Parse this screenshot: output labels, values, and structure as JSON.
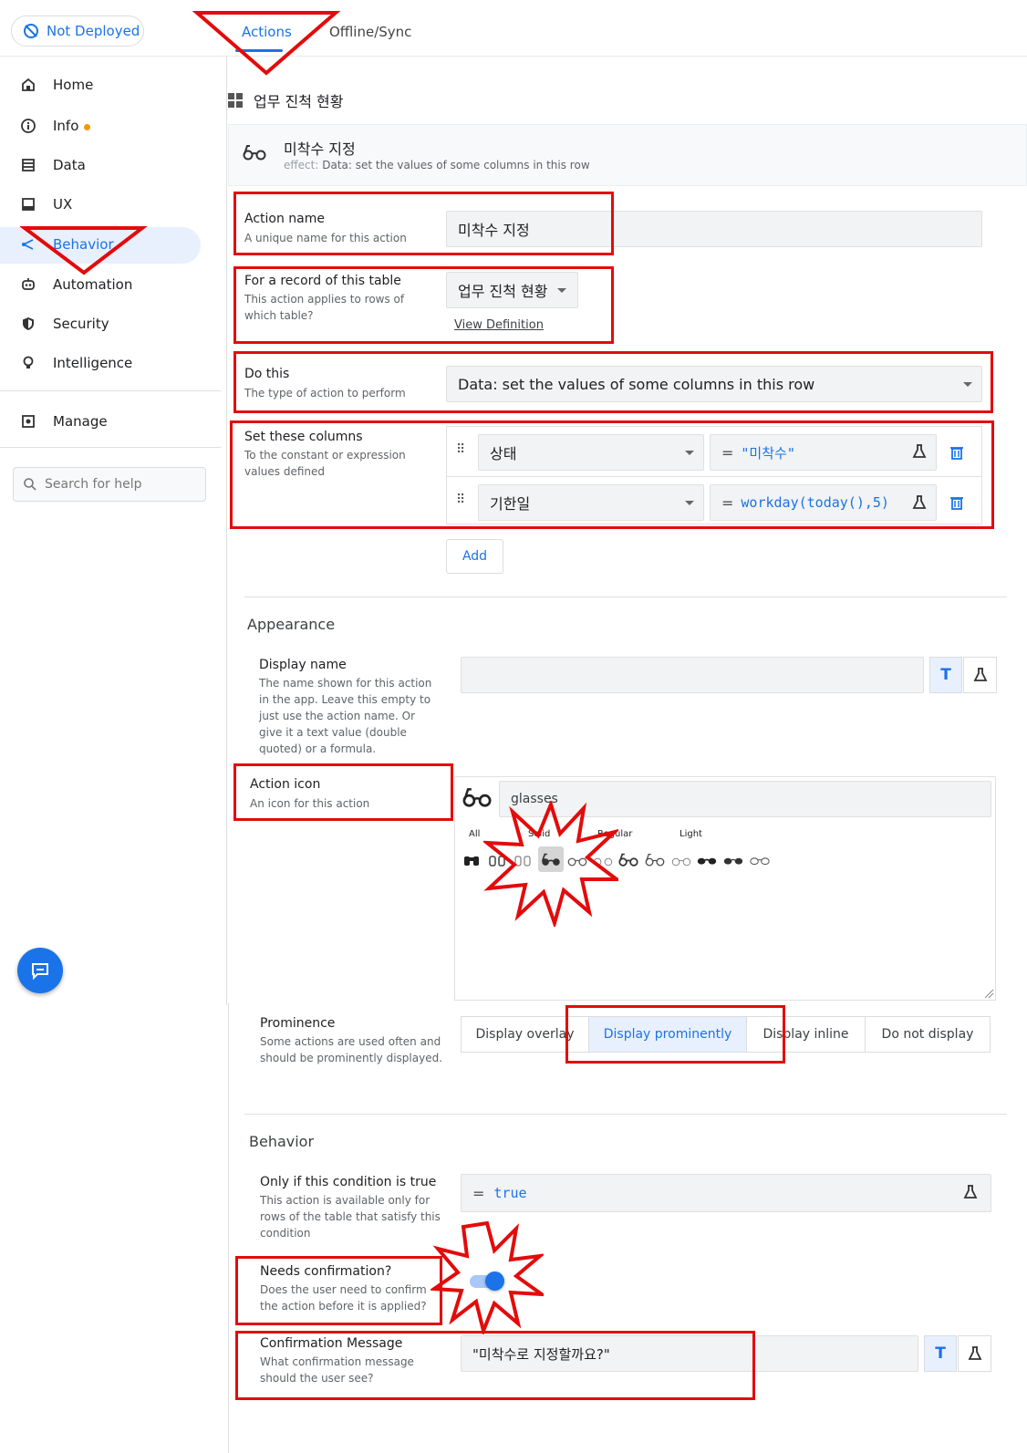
{
  "top": {
    "deploy_label": "Not Deployed",
    "tabs": [
      "Actions",
      "Offline/Sync"
    ]
  },
  "sidebar": {
    "items": [
      {
        "label": "Home",
        "icon": "home-icon"
      },
      {
        "label": "Info",
        "icon": "info-icon"
      },
      {
        "label": "Data",
        "icon": "data-icon"
      },
      {
        "label": "UX",
        "icon": "ux-icon"
      },
      {
        "label": "Behavior",
        "icon": "behavior-icon"
      },
      {
        "label": "Automation",
        "icon": "automation-icon"
      },
      {
        "label": "Security",
        "icon": "security-icon"
      },
      {
        "label": "Intelligence",
        "icon": "intelligence-icon"
      },
      {
        "label": "Manage",
        "icon": "manage-icon"
      }
    ],
    "search_placeholder": "Search for help"
  },
  "table_title": "업무 진척 현황",
  "action_card": {
    "name": "미착수 지정",
    "effect_label": "effect:",
    "effect_text": "Data: set the values of some columns in this row"
  },
  "form": {
    "action_name": {
      "label": "Action name",
      "help": "A unique name for this action",
      "value": "미착수 지정"
    },
    "record_table": {
      "label": "For a record of this table",
      "help": "This action applies to rows of which table?",
      "value": "업무 진척 현황",
      "link": "View Definition"
    },
    "do_this": {
      "label": "Do this",
      "help": "The type of action to perform",
      "value": "Data: set the values of some columns in this row"
    },
    "set_columns": {
      "label": "Set these columns",
      "help": "To the constant or expression values defined",
      "rows": [
        {
          "column": "상태",
          "expr": "\"미착수\""
        },
        {
          "column": "기한일",
          "expr": "workday(today(),5)"
        }
      ],
      "add_label": "Add"
    }
  },
  "appearance": {
    "title": "Appearance",
    "display_name": {
      "label": "Display name",
      "help": "The name shown for this action in the app. Leave this empty to just use the action name. Or give it a text value (double quoted) or a formula.",
      "value": ""
    },
    "action_icon": {
      "label": "Action icon",
      "help": "An icon for this action",
      "value": "glasses",
      "filters": [
        "All",
        "Solid",
        "Regular",
        "Light"
      ]
    },
    "prominence": {
      "label": "Prominence",
      "help": "Some actions are used often and should be prominently displayed.",
      "options": [
        "Display overlay",
        "Display prominently",
        "Display inline",
        "Do not display"
      ],
      "selected": "Display prominently"
    }
  },
  "behavior": {
    "title": "Behavior",
    "condition": {
      "label": "Only if this condition is true",
      "help": "This action is available only for rows of the table that satisfy this condition",
      "value": "true"
    },
    "needs_confirmation": {
      "label": "Needs confirmation?",
      "help": "Does the user need to confirm the action before it is applied?",
      "value": true
    },
    "confirmation_message": {
      "label": "Confirmation Message",
      "help": "What confirmation message should the user see?",
      "value": "\"미착수로 지정할까요?\""
    }
  },
  "colors": {
    "accent": "#1a73e8",
    "annotation": "#e30b0b"
  }
}
